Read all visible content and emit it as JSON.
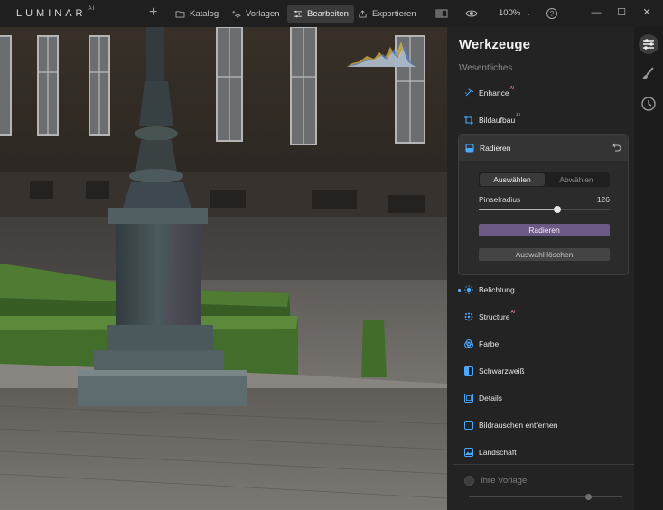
{
  "app": {
    "brand": "LUMINAR",
    "brand_suffix": "AI"
  },
  "topbar": {
    "add_label": "+",
    "nav": [
      {
        "label": "Katalog",
        "icon": "folder-icon"
      },
      {
        "label": "Vorlagen",
        "icon": "sparkle-icon"
      },
      {
        "label": "Bearbeiten",
        "icon": "sliders-icon",
        "active": true
      },
      {
        "label": "Exportieren",
        "icon": "share-icon"
      }
    ],
    "zoom": "100%",
    "window": {
      "minimize": "—",
      "maximize": "☐",
      "close": "✕"
    }
  },
  "panel": {
    "title": "Werkzeuge",
    "section": "Wesentliches",
    "tools_top": [
      {
        "label": "Enhance",
        "ai": "AI",
        "icon": "wand-icon"
      },
      {
        "label": "Bildaufbau",
        "ai": "AI",
        "icon": "crop-icon"
      }
    ],
    "erase": {
      "title": "Radieren",
      "seg_on": "Auswählen",
      "seg_off": "Abwählen",
      "brush_label": "Pinselradius",
      "brush_value": "126",
      "brush_fraction": 0.6,
      "erase_button": "Radieren",
      "clear_button": "Auswahl löschen"
    },
    "tools_bottom": [
      {
        "label": "Belichtung",
        "ai": "",
        "icon": "sun-icon"
      },
      {
        "label": "Structure",
        "ai": "AI",
        "icon": "structure-icon"
      },
      {
        "label": "Farbe",
        "ai": "",
        "icon": "color-icon"
      },
      {
        "label": "Schwarzweiß",
        "ai": "",
        "icon": "bw-icon"
      },
      {
        "label": "Details",
        "ai": "",
        "icon": "details-icon"
      },
      {
        "label": "Bildrauschen entfernen",
        "ai": "",
        "icon": "denoise-icon"
      },
      {
        "label": "Landschaft",
        "ai": "",
        "icon": "landscape-icon"
      }
    ],
    "preset_label": "Ihre Vorlage"
  },
  "colors": {
    "accent": "#6c5a86",
    "ai_badge": "#ff8ab0",
    "tool_icon": "#4aa8ff"
  }
}
